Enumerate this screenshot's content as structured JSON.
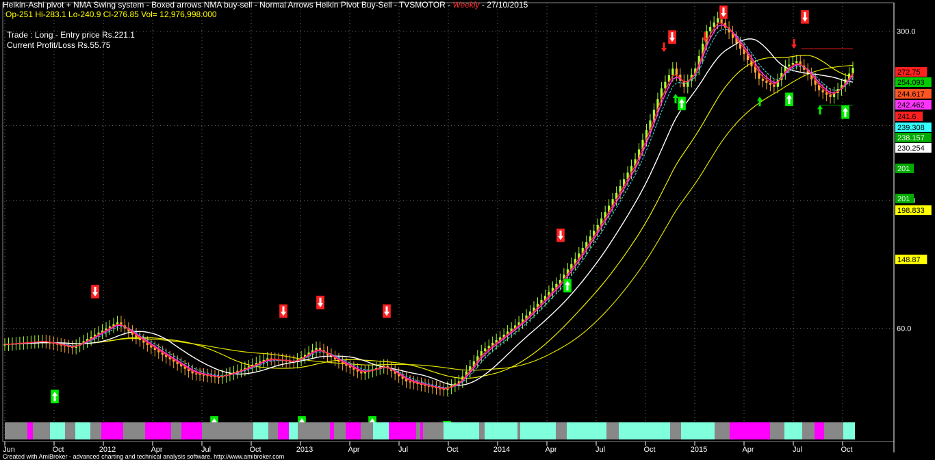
{
  "header": {
    "title": "Heikin-Ashi pivot + NMA Swing system - Boxed arrows NMA buy-sell - Normal Arrows Heikin Pivot Buy-Sell - TVSMOTOR - ",
    "interval": "Weekly",
    "date": "27/10/2015"
  },
  "ohlc": "Op-251  Hi-283.1  Lo-240.9  Cl-276.85  Vol= 12,976,998.000",
  "trade": {
    "line1": "Trade : Long - Entry price Rs.221.1",
    "line2": "Current Profit/Loss Rs.55.75"
  },
  "footer": "Created with AmiBroker - advanced charting and technical analysis software. http://www.amibroker.com",
  "colors": {
    "background": "#000000",
    "grid": "#6e6e6e",
    "bull_candle": "#aaff33",
    "bear_candle": "#ffaa33",
    "ma_fast": "#ff3030",
    "ma_mid": "#ff33ff",
    "ma_swing": "#33ccdd",
    "ma_long": "#ffffff",
    "ma_longer": "#eeee00",
    "ma_longest": "#dddd00",
    "buy_arrow": "#00ee00",
    "sell_arrow": "#ff2222"
  },
  "chart_data": {
    "type": "candlestick",
    "x_axis_labels": [
      "Jun",
      "Oct",
      "2012",
      "Apr",
      "Jul",
      "Oct",
      "2013",
      "Apr",
      "Jul",
      "Oct",
      "2014",
      "Apr",
      "Jul",
      "Oct",
      "2015",
      "Apr",
      "Jul",
      "Oct"
    ],
    "y_axis_labels": [
      "300.0",
      "180.0",
      "120.0",
      "60.0"
    ],
    "y_axis_ticks": [
      300,
      180,
      120,
      60
    ],
    "ylim": [
      35,
      350
    ],
    "y_scale": "log",
    "grid": true,
    "price_tags": [
      {
        "label": "272.75",
        "bg": "#ff2020",
        "fg": "#000000"
      },
      {
        "label": "254.093",
        "bg": "#00cc00",
        "fg": "#000000"
      },
      {
        "label": "244.617",
        "bg": "#ff5522",
        "fg": "#000000"
      },
      {
        "label": "242.462",
        "bg": "#ff33ff",
        "fg": "#000000"
      },
      {
        "label": "241.6",
        "bg": "#ff2020",
        "fg": "#000000"
      },
      {
        "label": "239.308",
        "bg": "#33ffff",
        "fg": "#000000"
      },
      {
        "label": "238.157",
        "bg": "#00aa00",
        "fg": "#ffffff"
      },
      {
        "label": "230.254",
        "bg": "#ffffff",
        "fg": "#000000"
      },
      {
        "label": "201",
        "bg": "#00aa00",
        "fg": "#ffffff"
      },
      {
        "label": "201",
        "bg": "#00aa00",
        "fg": "#ffffff"
      },
      {
        "label": "198.833",
        "bg": "#ffff00",
        "fg": "#000000"
      },
      {
        "label": "148.87",
        "bg": "#ffff00",
        "fg": "#000000"
      }
    ],
    "price_tag_values": [
      272.75,
      254.093,
      244.617,
      242.462,
      241.6,
      239.308,
      238.157,
      230.254,
      201,
      201,
      198.833,
      148.87
    ],
    "price_path_key": [
      [
        0,
        55
      ],
      [
        10,
        56
      ],
      [
        18,
        54
      ],
      [
        24,
        58
      ],
      [
        30,
        62
      ],
      [
        35,
        57
      ],
      [
        42,
        52
      ],
      [
        50,
        47
      ],
      [
        57,
        46
      ],
      [
        63,
        48
      ],
      [
        70,
        51
      ],
      [
        77,
        50
      ],
      [
        83,
        54
      ],
      [
        89,
        50
      ],
      [
        95,
        47
      ],
      [
        101,
        49
      ],
      [
        107,
        45
      ],
      [
        112,
        44
      ],
      [
        117,
        43
      ],
      [
        121,
        45
      ],
      [
        127,
        53
      ],
      [
        133,
        58
      ],
      [
        138,
        63
      ],
      [
        143,
        70
      ],
      [
        148,
        78
      ],
      [
        153,
        90
      ],
      [
        158,
        105
      ],
      [
        163,
        125
      ],
      [
        168,
        150
      ],
      [
        172,
        185
      ],
      [
        175,
        220
      ],
      [
        178,
        245
      ],
      [
        181,
        222
      ],
      [
        184,
        245
      ],
      [
        187,
        300
      ],
      [
        190,
        322
      ],
      [
        193,
        298
      ],
      [
        197,
        265
      ],
      [
        201,
        232
      ],
      [
        205,
        222
      ],
      [
        208,
        248
      ],
      [
        211,
        255
      ],
      [
        214,
        238
      ],
      [
        217,
        218
      ],
      [
        220,
        210
      ],
      [
        223,
        224
      ],
      [
        226,
        246
      ]
    ],
    "buy_signal_values": [
      45,
      39,
      39,
      39,
      38,
      82,
      220,
      225,
      210,
      226
    ],
    "sell_signal_values": [
      70,
      63,
      66,
      63,
      95,
      278,
      330,
      310,
      278
    ]
  }
}
